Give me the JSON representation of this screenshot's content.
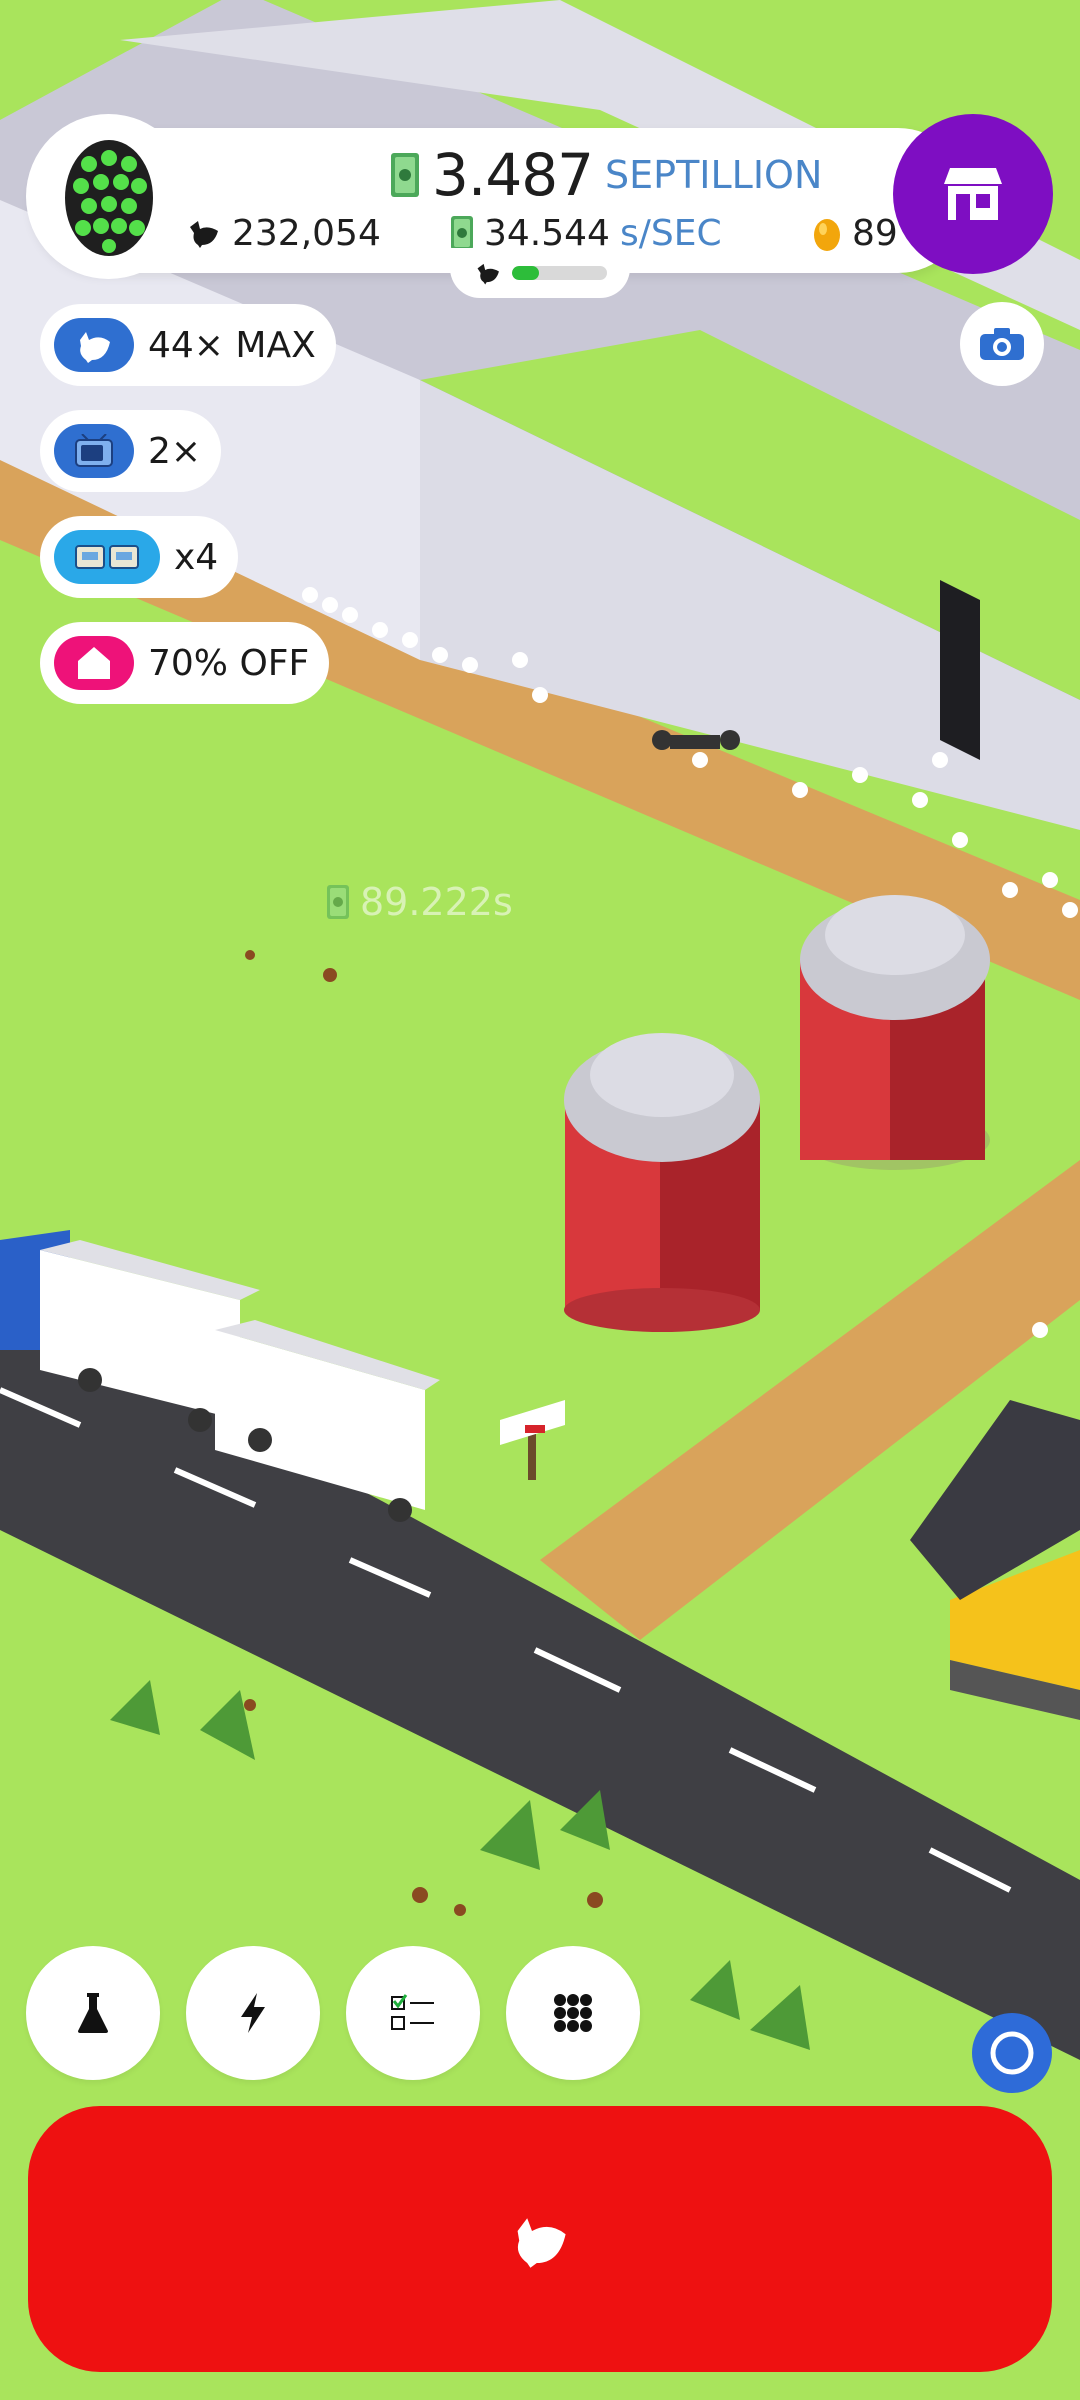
{
  "hud": {
    "money_value": "3.487",
    "money_unit": "SEPTILLION",
    "chicken_count": "232,054",
    "income_value": "34.544",
    "income_unit": "s/SEC",
    "golden_eggs": "89",
    "egg_type_icon": "green-egg-icon",
    "progress_fraction": 0.28
  },
  "boosts": [
    {
      "icon": "chicken-icon",
      "label": "44× MAX",
      "color": "#2f6fd0"
    },
    {
      "icon": "tv-icon",
      "label": "2×",
      "color": "#2f6fd0"
    },
    {
      "icon": "boost-cards-icon",
      "label": "x4",
      "color": "#2aa8e8"
    },
    {
      "icon": "home-icon",
      "label": "70% OFF",
      "color": "#ee1279"
    }
  ],
  "floating_income": "89.222s",
  "toolbar": [
    {
      "icon": "flask-icon",
      "name": "research-button"
    },
    {
      "icon": "lightning-icon",
      "name": "boosts-button"
    },
    {
      "icon": "checklist-icon",
      "name": "missions-button"
    },
    {
      "icon": "grid-icon",
      "name": "menu-button"
    }
  ],
  "colors": {
    "grass": "#a9e45c",
    "shop": "#7e0ec2",
    "hatch_button": "#ee1111",
    "accent_blue": "#4a86c8"
  }
}
